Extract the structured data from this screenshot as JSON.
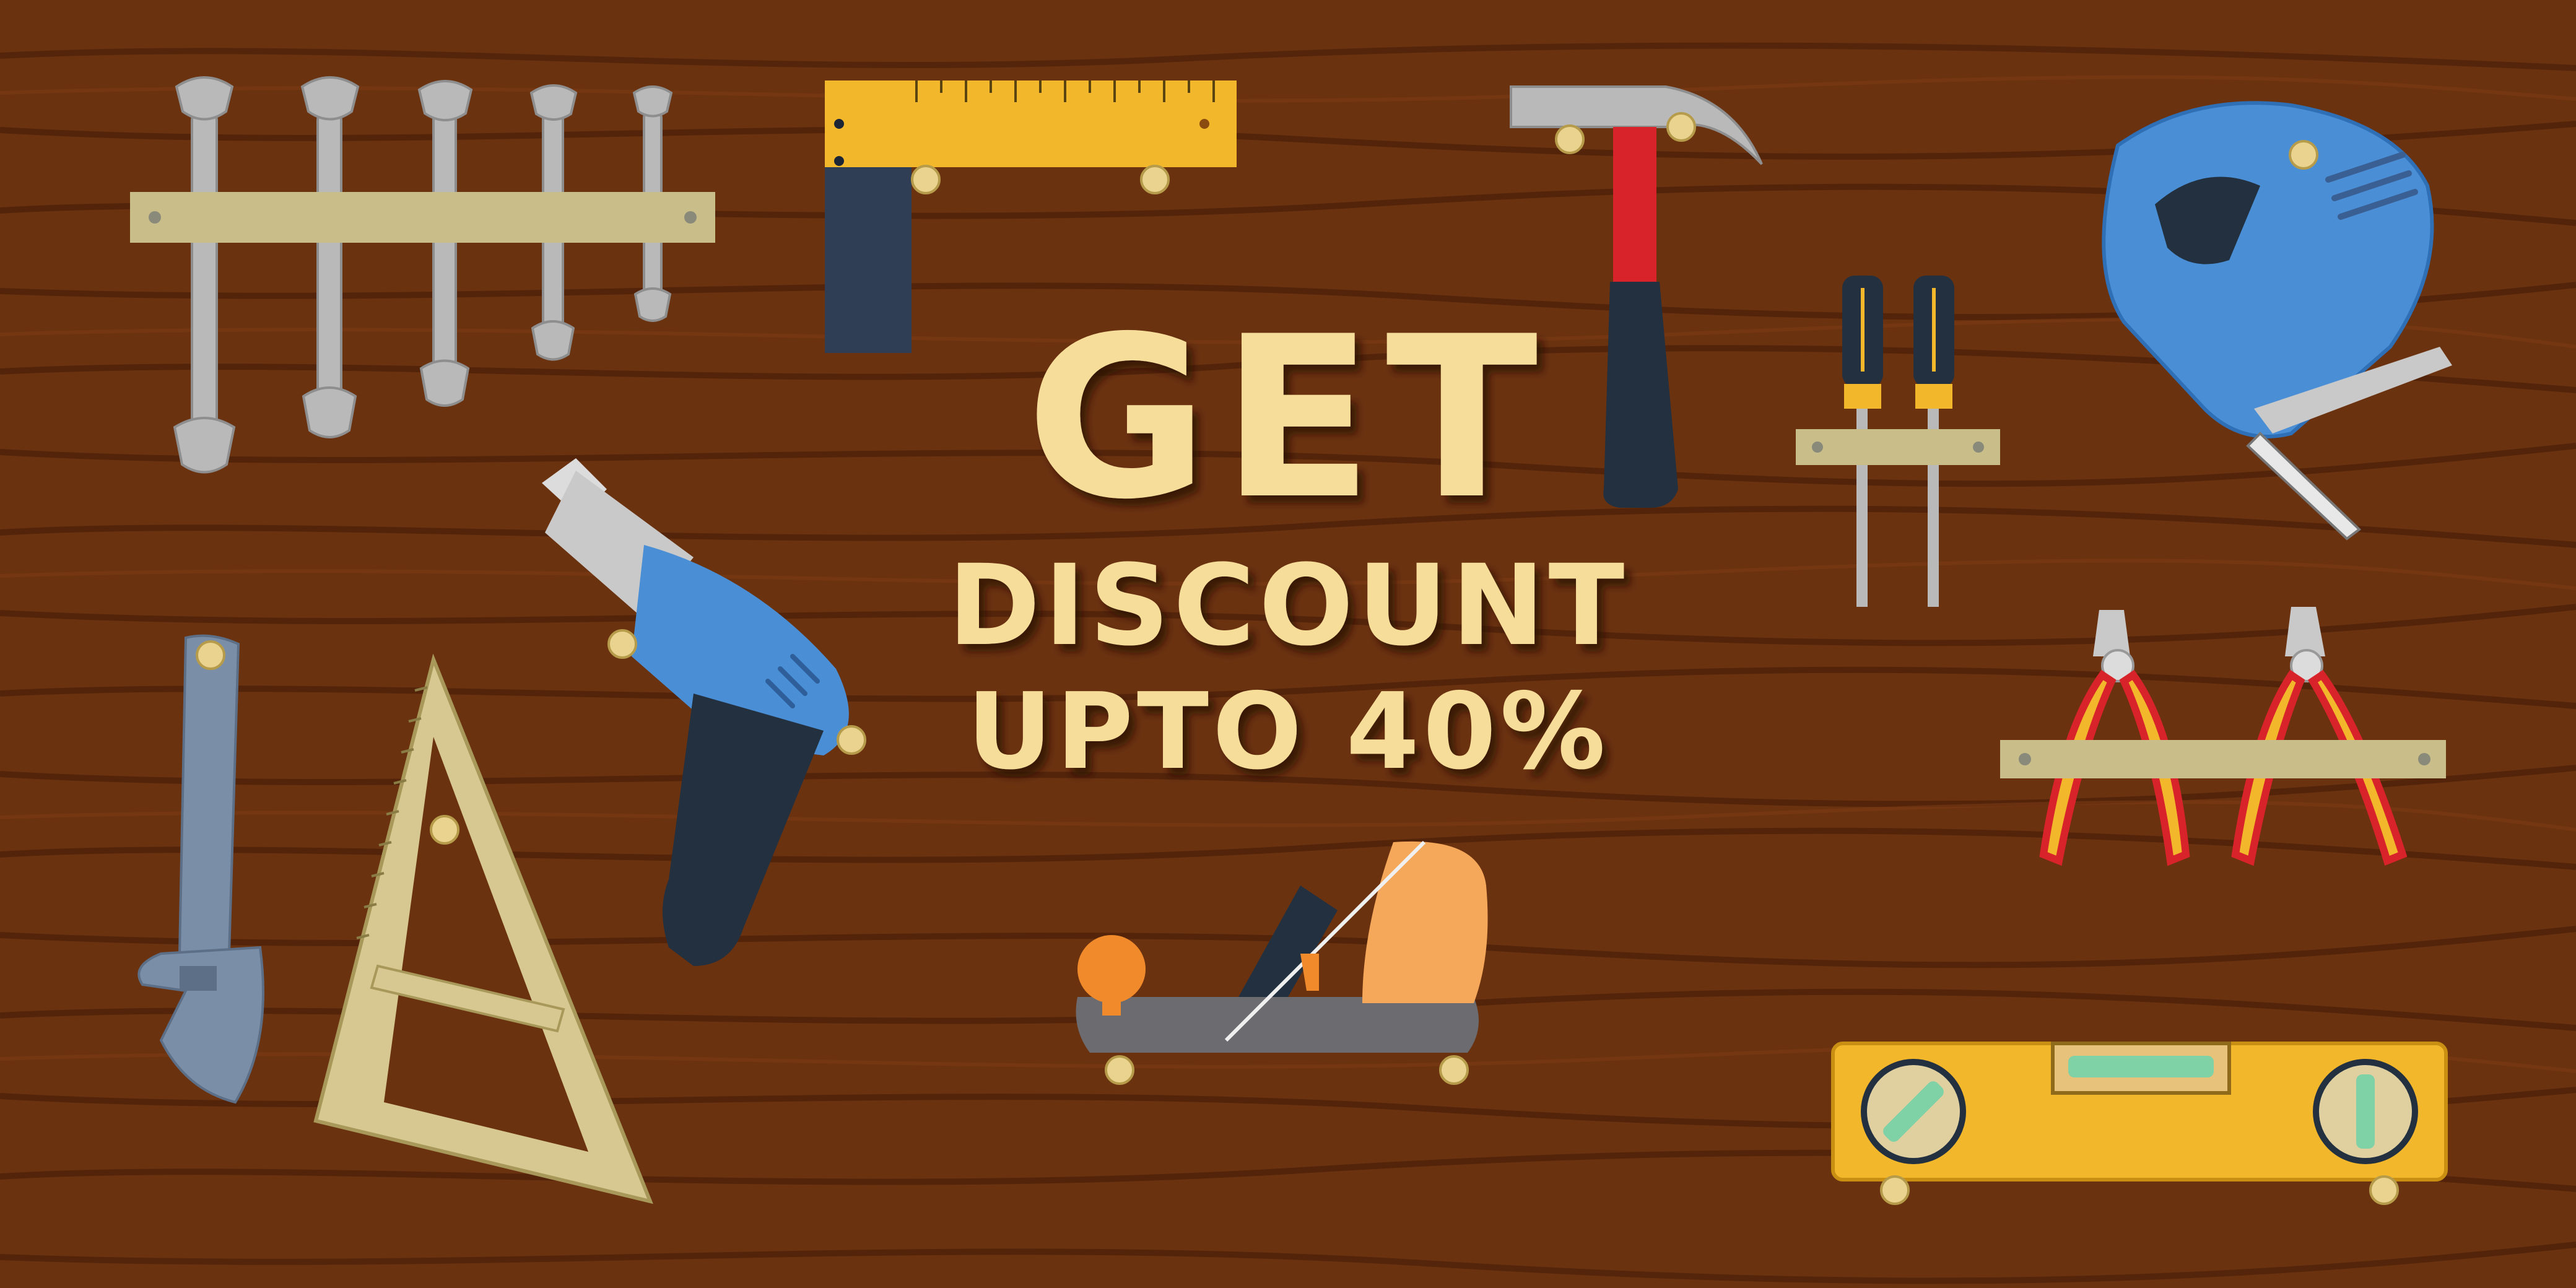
{
  "promo": {
    "headline": "GET",
    "line2": "DISCOUNT",
    "line3": "UPTO 40%"
  },
  "colors": {
    "wood": "#6b3210",
    "wood_grain": "#4a1f08",
    "text": "#f6dd9a",
    "text_shadow": "#3a1a06",
    "board": "#c9bd8a",
    "tool_gray": "#b7b7b7",
    "tool_blue": "#4a8fd6",
    "tool_dark": "#22303f",
    "tool_yellow": "#f3b72b",
    "tool_red": "#d8232a",
    "tool_orange": "#f08a2a",
    "pin": "#e9d38f"
  },
  "tools": [
    "wrench-set-icon",
    "carpenter-square-icon",
    "claw-hammer-icon",
    "screwdriver-pair-icon",
    "jigsaw-icon",
    "adjustable-wrench-icon",
    "triangle-ruler-icon",
    "power-drill-icon",
    "hand-plane-icon",
    "pliers-pair-icon",
    "spirit-level-icon"
  ]
}
